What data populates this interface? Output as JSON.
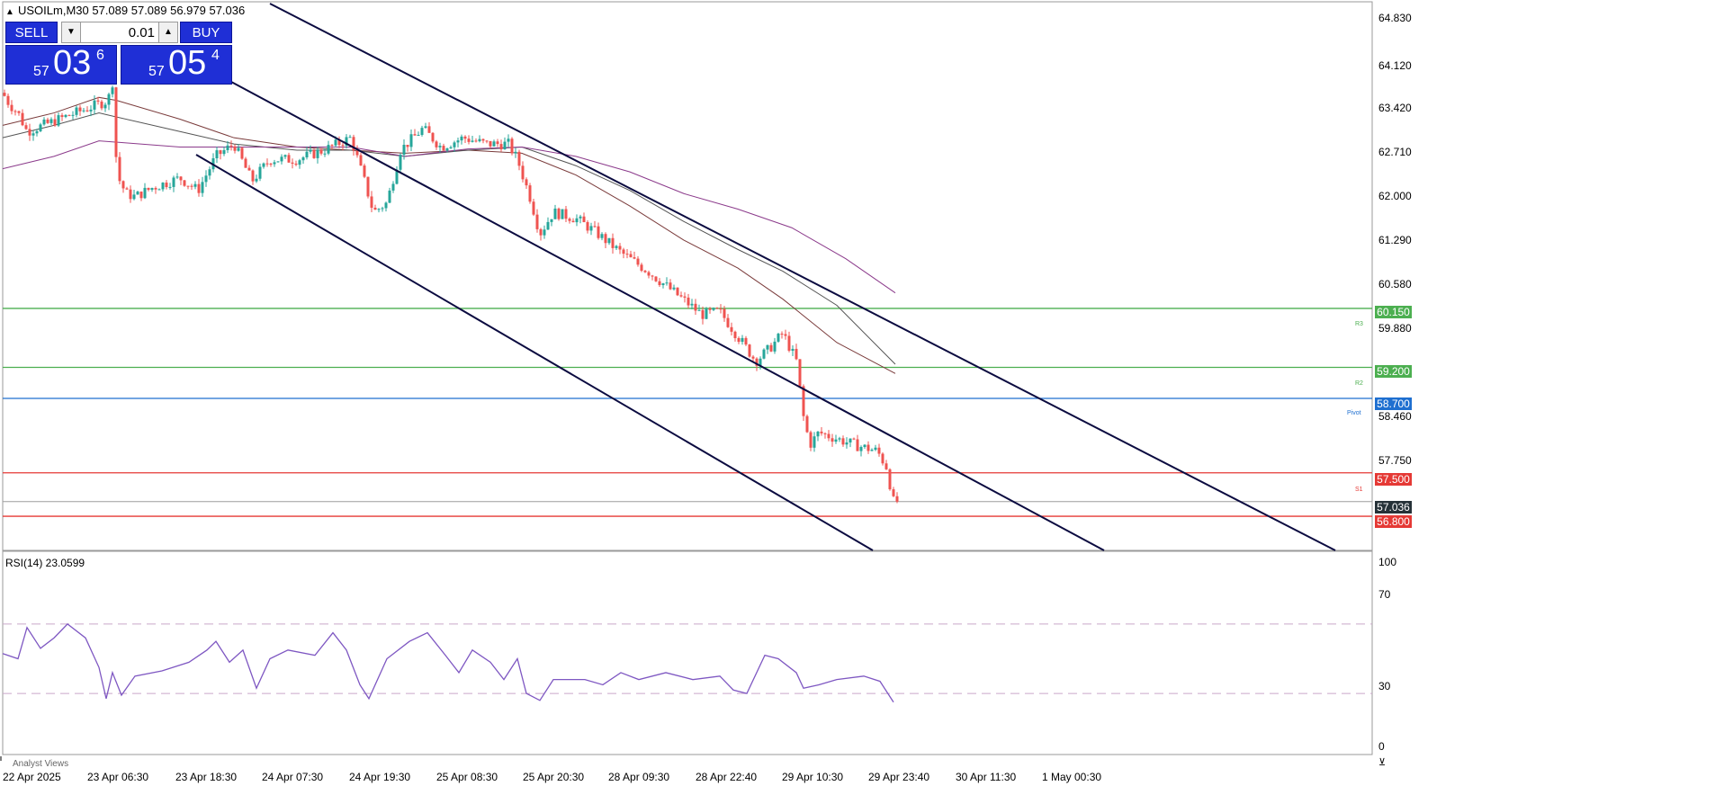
{
  "header": {
    "symbol_line": "USOILm,M30  57.089 57.089 56.979 57.036"
  },
  "trade_panel": {
    "sell_label": "SELL",
    "buy_label": "BUY",
    "volume": "0.01",
    "sell_price": {
      "prefix": "57",
      "big": "03",
      "sup": "6"
    },
    "buy_price": {
      "prefix": "57",
      "big": "05",
      "sup": "4"
    }
  },
  "price_axis": {
    "ticks": [
      "64.830",
      "64.120",
      "63.420",
      "62.710",
      "62.000",
      "61.290",
      "60.580",
      "59.880",
      "58.460",
      "57.750"
    ],
    "tags": {
      "r3": "60.150",
      "r2": "59.200",
      "pivot": "58.700",
      "s1": "57.500",
      "current": "57.036",
      "low": "56.800"
    },
    "line_labels": {
      "r3": "R3",
      "r2": "R2",
      "pivot": "Pivot",
      "s1": "S1"
    }
  },
  "rsi_panel": {
    "label": "RSI(14) 23.0599",
    "ticks": [
      "100",
      "70",
      "30",
      "0"
    ]
  },
  "time_axis": {
    "labels": [
      "22 Apr 2025",
      "23 Apr 06:30",
      "23 Apr 18:30",
      "24 Apr 07:30",
      "24 Apr 19:30",
      "25 Apr 08:30",
      "25 Apr 20:30",
      "28 Apr 09:30",
      "28 Apr 22:40",
      "29 Apr 10:30",
      "29 Apr 23:40",
      "30 Apr 11:30",
      "1 May 00:30"
    ]
  },
  "footer": {
    "tab_label": "Analyst Views"
  },
  "colors": {
    "up": "#26a69a",
    "down": "#ef5350",
    "rsi": "#7e57c2",
    "resistance": "#4caf50",
    "pivot": "#1e6fd0",
    "support": "#e53935",
    "channel": "#0b0b40"
  }
}
